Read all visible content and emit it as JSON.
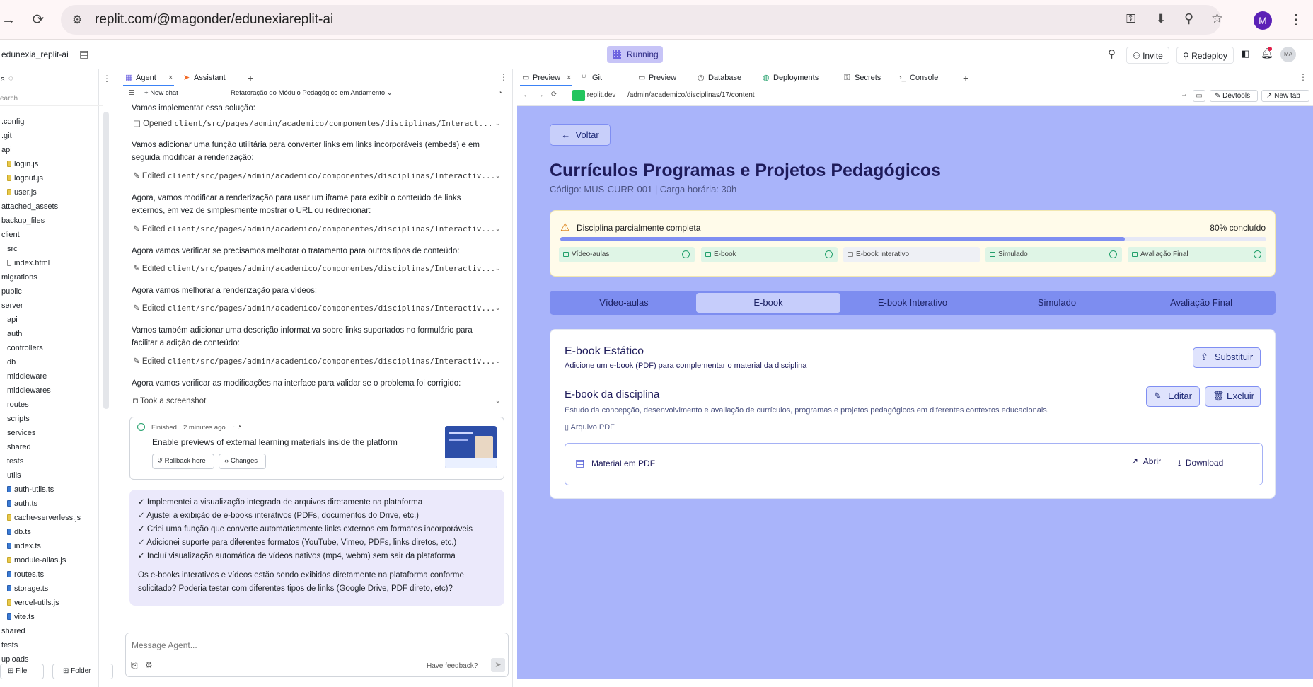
{
  "browser": {
    "url": "replit.com/@magonder/edunexiareplit-ai",
    "profile_initial": "M"
  },
  "topbar": {
    "project_name": "edunexia_replit-ai",
    "status": "Running",
    "invite": "Invite",
    "redeploy": "Redeploy",
    "user_initials": "MA"
  },
  "files": {
    "header": "s",
    "search_placeholder": "earch",
    "items": [
      ".config",
      ".git",
      "api",
      "login.js",
      "logout.js",
      "user.js",
      "attached_assets",
      "backup_files",
      "client",
      "src",
      "index.html",
      "migrations",
      "public",
      "server",
      "api",
      "auth",
      "controllers",
      "db",
      "middleware",
      "middlewares",
      "routes",
      "scripts",
      "services",
      "shared",
      "tests",
      "utils",
      "auth-utils.ts",
      "auth.ts",
      "cache-serverless.js",
      "db.ts",
      "index.ts",
      "module-alias.js",
      "routes.ts",
      "storage.ts",
      "vercel-utils.js",
      "vite.ts",
      "shared",
      "tests",
      "uploads"
    ],
    "new_file": "File",
    "new_folder": "Folder"
  },
  "agent": {
    "tab_agent": "Agent",
    "tab_assistant": "Assistant",
    "new_chat": "New chat",
    "chat_title": "Refatoração do Módulo Pedagógico em Andamento",
    "messages": [
      "Vamos implementar essa solução:",
      "Vamos adicionar uma função utilitária para converter links em links incorporáveis (embeds) e em seguida modificar a renderização:",
      "Agora, vamos modificar a renderização para usar um iframe para exibir o conteúdo de links externos, em vez de simplesmente mostrar o URL ou redirecionar:",
      "Agora vamos verificar se precisamos melhorar o tratamento para outros tipos de conteúdo:",
      "Agora vamos melhorar a renderização para vídeos:",
      "Vamos também adicionar uma descrição informativa sobre links suportados no formulário para facilitar a adição de conteúdo:",
      "Agora vamos verificar as modificações na interface para validar se o problema foi corrigido:"
    ],
    "actions": [
      {
        "verb": "Opened",
        "path": "client/src/pages/admin/academico/componentes/disciplinas/Interact..."
      },
      {
        "verb": "Edited",
        "path": "client/src/pages/admin/academico/componentes/disciplinas/Interactiv..."
      },
      {
        "verb": "Edited",
        "path": "client/src/pages/admin/academico/componentes/disciplinas/Interactiv..."
      },
      {
        "verb": "Edited",
        "path": "client/src/pages/admin/academico/componentes/disciplinas/Interactiv..."
      },
      {
        "verb": "Edited",
        "path": "client/src/pages/admin/academico/componentes/disciplinas/Interactiv..."
      },
      {
        "verb": "Edited",
        "path": "client/src/pages/admin/academico/componentes/disciplinas/Interactiv..."
      }
    ],
    "screenshot": "Took a screenshot",
    "finished_label": "Finished",
    "finished_time": "2 minutes ago",
    "checkpoint_title": "Enable previews of external learning materials inside the platform",
    "rollback": "Rollback here",
    "changes": "Changes",
    "summary_items": [
      "✓ Implementei a visualização integrada de arquivos diretamente na plataforma",
      "✓ Ajustei a exibição de e-books interativos (PDFs, documentos do Drive, etc.)",
      "✓ Criei uma função que converte automaticamente links externos em formatos incorporáveis",
      "✓ Adicionei suporte para diferentes formatos (YouTube, Vimeo, PDFs, links diretos, etc.)",
      "✓ Incluí visualização automática de vídeos nativos (mp4, webm) sem sair da plataforma"
    ],
    "summary_question": "Os e-books interativos e vídeos estão sendo exibidos diretamente na plataforma conforme solicitado? Poderia testar com diferentes tipos de links (Google Drive, PDF direto, etc)?",
    "input_placeholder": "Message Agent...",
    "feedback": "Have feedback?"
  },
  "preview_tabs": [
    "Preview",
    "Git",
    "Preview",
    "Database",
    "Deployments",
    "Secrets",
    "Console"
  ],
  "preview_bar": {
    "domain": ".replit.dev",
    "path": "/admin/academico/disciplinas/17/content",
    "devtools": "Devtools",
    "new_tab": "New tab"
  },
  "page": {
    "back": "Voltar",
    "title": "Currículos Programas e Projetos Pedagógicos",
    "subtitle": "Código: MUS-CURR-001 | Carga horária: 30h",
    "status_title": "Disciplina parcialmente completa",
    "progress_label": "80% concluído",
    "progress_value": 0.8,
    "chips": [
      {
        "label": "Vídeo-aulas",
        "done": true
      },
      {
        "label": "E-book",
        "done": true
      },
      {
        "label": "E-book interativo",
        "done": false
      },
      {
        "label": "Simulado",
        "done": true
      },
      {
        "label": "Avaliação Final",
        "done": true
      }
    ],
    "tabs": [
      "Vídeo-aulas",
      "E-book",
      "E-book Interativo",
      "Simulado",
      "Avaliação Final"
    ],
    "active_tab": "E-book",
    "section_title": "E-book Estático",
    "section_desc": "Adicione um e-book (PDF) para complementar o material da disciplina",
    "replace": "Substituir",
    "ebook_title": "E-book da disciplina",
    "ebook_desc": "Estudo da concepção, desenvolvimento e avaliação de currículos, programas e projetos pedagógicos em diferentes contextos educacionais.",
    "file_type": "Arquivo PDF",
    "edit": "Editar",
    "delete": "Excluir",
    "material": "Material em PDF",
    "open": "Abrir",
    "download": "Download"
  },
  "colors": {
    "viewport_bg": "#a9b4fa",
    "accent": "#1e2a78",
    "progress": "#7f8ef2",
    "done_chip": "#dff5e6"
  }
}
